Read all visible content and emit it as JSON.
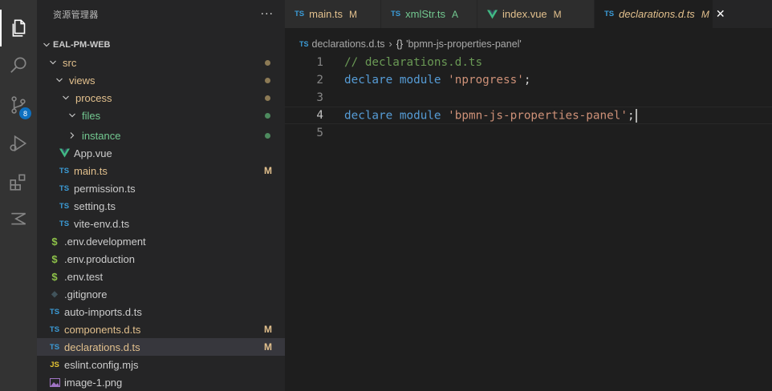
{
  "activity_bar": {
    "items": [
      {
        "name": "explorer-icon",
        "active": true
      },
      {
        "name": "search-icon"
      },
      {
        "name": "source-control-icon",
        "badge": "8"
      },
      {
        "name": "run-debug-icon"
      },
      {
        "name": "extensions-icon"
      },
      {
        "name": "remote-icon"
      }
    ]
  },
  "sidebar": {
    "title": "资源管理器",
    "more": "···",
    "root": "EAL-PM-WEB",
    "tree": [
      {
        "label": "src",
        "kind": "folder-open",
        "indent": 1,
        "status": "dot-mod"
      },
      {
        "label": "views",
        "kind": "folder-open",
        "indent": 2,
        "status": "dot-mod"
      },
      {
        "label": "process",
        "kind": "folder-open",
        "indent": 3,
        "status": "dot-mod"
      },
      {
        "label": "files",
        "kind": "folder-open",
        "indent": 4,
        "status": "dot-green"
      },
      {
        "label": "instance",
        "kind": "folder-closed",
        "indent": 4,
        "status": "dot-green"
      },
      {
        "label": "App.vue",
        "kind": "vue",
        "indent": 2,
        "status": ""
      },
      {
        "label": "main.ts",
        "kind": "ts",
        "indent": 2,
        "status": "M"
      },
      {
        "label": "permission.ts",
        "kind": "ts",
        "indent": 2,
        "status": ""
      },
      {
        "label": "setting.ts",
        "kind": "ts",
        "indent": 2,
        "status": ""
      },
      {
        "label": "vite-env.d.ts",
        "kind": "ts",
        "indent": 2,
        "status": ""
      },
      {
        "label": ".env.development",
        "kind": "env",
        "indent": 1,
        "status": ""
      },
      {
        "label": ".env.production",
        "kind": "env",
        "indent": 1,
        "status": ""
      },
      {
        "label": ".env.test",
        "kind": "env",
        "indent": 1,
        "status": ""
      },
      {
        "label": ".gitignore",
        "kind": "git",
        "indent": 1,
        "status": ""
      },
      {
        "label": "auto-imports.d.ts",
        "kind": "ts",
        "indent": 0,
        "status": ""
      },
      {
        "label": "components.d.ts",
        "kind": "ts",
        "indent": 0,
        "status": "M"
      },
      {
        "label": "declarations.d.ts",
        "kind": "ts",
        "indent": 0,
        "status": "M",
        "selected": true
      },
      {
        "label": "eslint.config.mjs",
        "kind": "js",
        "indent": 0,
        "status": ""
      },
      {
        "label": "image-1.png",
        "kind": "img",
        "indent": 0,
        "status": ""
      }
    ],
    "status_m": "M"
  },
  "tabs": [
    {
      "label": "main.ts",
      "icon": "TS",
      "status": "M",
      "label_color": "#e2c08d",
      "status_color": "#e2c08d",
      "italic": false
    },
    {
      "label": "xmlStr.ts",
      "icon": "TS",
      "status": "A",
      "label_color": "#73c991",
      "status_color": "#73c991",
      "italic": false
    },
    {
      "label": "index.vue",
      "icon": "vue",
      "status": "M",
      "label_color": "#e2c08d",
      "status_color": "#e2c08d",
      "italic": false
    },
    {
      "label": "declarations.d.ts",
      "icon": "TS",
      "status": "M",
      "label_color": "#e2c08d",
      "status_color": "#e2c08d",
      "italic": true,
      "active": true,
      "close": "✕"
    }
  ],
  "breadcrumb": {
    "file_icon": "TS",
    "file": "declarations.d.ts",
    "separator": "›",
    "symbol_icon": "{}",
    "symbol": "'bpmn-js-properties-panel'"
  },
  "code": {
    "lines": [
      {
        "number": "1",
        "tokens": [
          {
            "t": "// declarations.d.ts",
            "c": "comment"
          }
        ]
      },
      {
        "number": "2",
        "tokens": [
          {
            "t": "declare",
            "c": "kw"
          },
          {
            "t": " ",
            "c": "punc"
          },
          {
            "t": "module",
            "c": "kw"
          },
          {
            "t": " ",
            "c": "punc"
          },
          {
            "t": "'nprogress'",
            "c": "str"
          },
          {
            "t": ";",
            "c": "punc"
          }
        ]
      },
      {
        "number": "3",
        "tokens": []
      },
      {
        "number": "4",
        "tokens": [
          {
            "t": "declare",
            "c": "kw"
          },
          {
            "t": " ",
            "c": "punc"
          },
          {
            "t": "module",
            "c": "kw"
          },
          {
            "t": " ",
            "c": "punc"
          },
          {
            "t": "'bpmn-js-properties-panel'",
            "c": "str"
          },
          {
            "t": ";",
            "c": "punc"
          }
        ],
        "current": true
      },
      {
        "number": "5",
        "tokens": []
      }
    ]
  },
  "colors": {
    "modified": "#e2c08d",
    "added": "#73c991",
    "accent": "#0e70c0"
  }
}
